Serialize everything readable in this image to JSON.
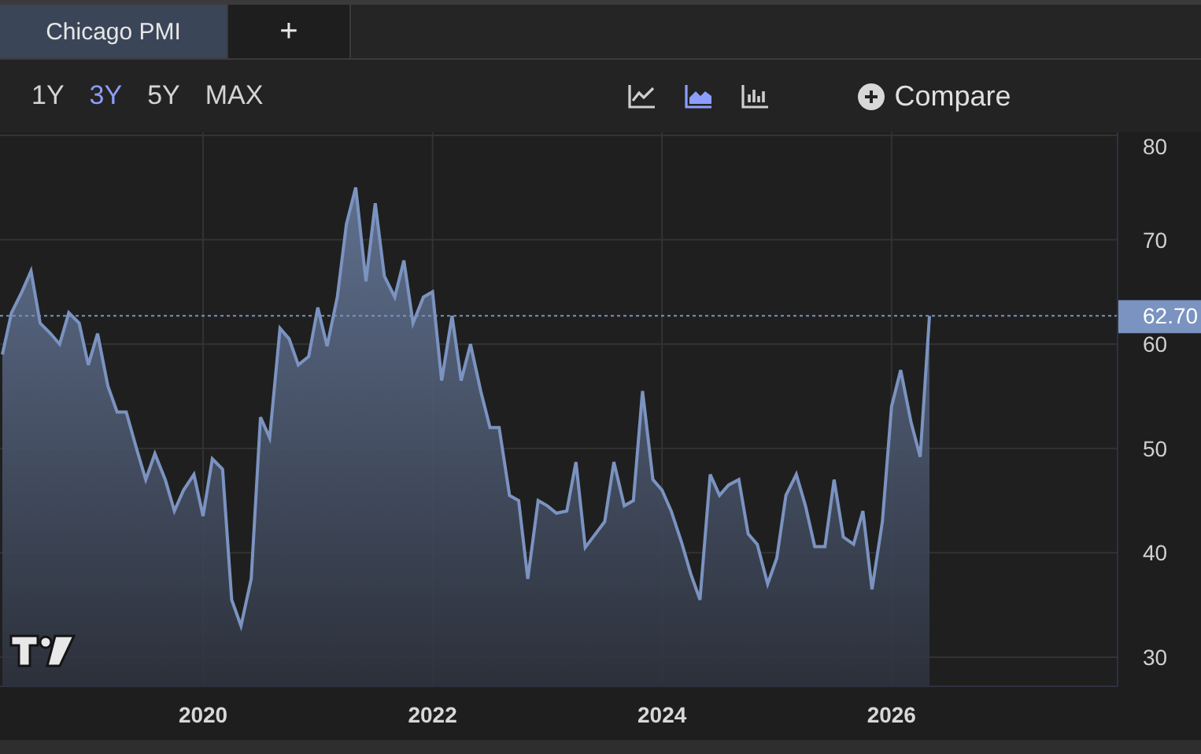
{
  "tabs": [
    {
      "label": "Chicago PMI",
      "selected": true
    },
    {
      "label": "+",
      "selected": false
    }
  ],
  "ranges": [
    {
      "label": "1Y",
      "selected": false
    },
    {
      "label": "3Y",
      "selected": true
    },
    {
      "label": "5Y",
      "selected": false
    },
    {
      "label": "MAX",
      "selected": false
    }
  ],
  "chart_types": [
    {
      "kind": "line",
      "selected": false
    },
    {
      "kind": "area",
      "selected": true
    },
    {
      "kind": "bars",
      "selected": false
    }
  ],
  "compare_button": {
    "label": "Compare"
  },
  "chart": {
    "chart_data": {
      "type": "area",
      "grid": true,
      "xlim": [
        2018.23,
        2027.97
      ],
      "ylim": [
        27.2,
        80.3
      ],
      "xticks": [
        2020,
        2022,
        2024,
        2026
      ],
      "yticks": [
        30,
        40,
        50,
        60,
        70,
        80
      ],
      "ref_lines": [
        {
          "axis": "y",
          "value": 62.7,
          "label": "62.70"
        }
      ],
      "x": [
        2018.25,
        2018.33,
        2018.42,
        2018.5,
        2018.58,
        2018.67,
        2018.75,
        2018.83,
        2018.92,
        2019.0,
        2019.08,
        2019.17,
        2019.25,
        2019.33,
        2019.42,
        2019.5,
        2019.58,
        2019.67,
        2019.75,
        2019.83,
        2019.92,
        2020.0,
        2020.08,
        2020.17,
        2020.25,
        2020.33,
        2020.42,
        2020.5,
        2020.58,
        2020.67,
        2020.75,
        2020.83,
        2020.92,
        2021.0,
        2021.08,
        2021.17,
        2021.25,
        2021.33,
        2021.42,
        2021.5,
        2021.58,
        2021.67,
        2021.75,
        2021.83,
        2021.92,
        2022.0,
        2022.08,
        2022.17,
        2022.25,
        2022.33,
        2022.42,
        2022.5,
        2022.58,
        2022.67,
        2022.75,
        2022.83,
        2022.92,
        2023.0,
        2023.08,
        2023.17,
        2023.25,
        2023.33,
        2023.42,
        2023.5,
        2023.58,
        2023.67,
        2023.75,
        2023.83,
        2023.92,
        2024.0,
        2024.08,
        2024.17,
        2024.25,
        2024.33,
        2024.42,
        2024.5,
        2024.58,
        2024.67,
        2024.75,
        2024.83,
        2024.92,
        2025.0,
        2025.08,
        2025.17,
        2025.25,
        2025.33,
        2025.42,
        2025.5,
        2025.58,
        2025.67,
        2025.75,
        2025.83,
        2025.92,
        2026.0,
        2026.08,
        2026.17,
        2026.25,
        2026.33
      ],
      "series": [
        {
          "color": "#7b93c0",
          "values": [
            59,
            63,
            65,
            67,
            62,
            61,
            60,
            63,
            62,
            58,
            61,
            56,
            53.5,
            53.5,
            50,
            47,
            49.5,
            47,
            44,
            46,
            47.5,
            43.5,
            49,
            48,
            35.5,
            33,
            37.5,
            53,
            51,
            61.5,
            60.5,
            58,
            58.8,
            63.5,
            59.8,
            64.5,
            71.5,
            75,
            66,
            73.5,
            66.5,
            64.5,
            68,
            62,
            64.5,
            65,
            56.5,
            62.7,
            56.5,
            60,
            55.5,
            52,
            52,
            45.5,
            45,
            37.5,
            45,
            44.5,
            43.8,
            44,
            48.7,
            40.5,
            41.8,
            43,
            48.7,
            44.5,
            45,
            55.5,
            47,
            46,
            44,
            41,
            38,
            35.5,
            47.5,
            45.5,
            46.5,
            47,
            41.8,
            40.8,
            37,
            39.5,
            45.5,
            47.5,
            44.5,
            40.6,
            40.6,
            47,
            41.5,
            40.8,
            44,
            36.5,
            43,
            54,
            57.5,
            52.5,
            49.2,
            62.7
          ]
        }
      ]
    }
  }
}
